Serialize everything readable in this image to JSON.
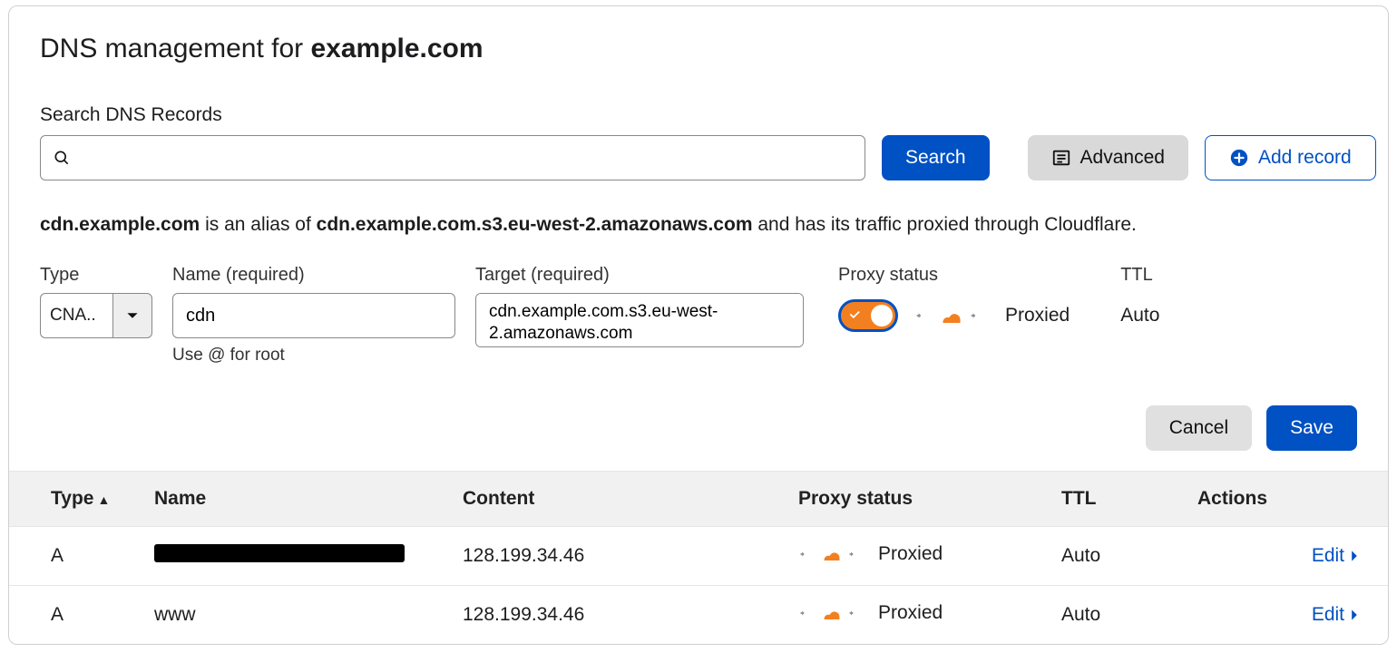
{
  "title_prefix": "DNS management for ",
  "title_domain": "example.com",
  "search": {
    "label": "Search DNS Records",
    "placeholder": "",
    "button": "Search",
    "advanced": "Advanced",
    "add_record": "Add record"
  },
  "alias_sentence": {
    "host": "cdn.example.com",
    "mid": " is an alias of ",
    "target": "cdn.example.com.s3.eu-west-2.amazonaws.com",
    "tail": " and has its traffic proxied through Cloudflare."
  },
  "form": {
    "type_label": "Type",
    "type_value": "CNA..",
    "name_label": "Name (required)",
    "name_value": "cdn",
    "name_hint": "Use @ for root",
    "target_label": "Target (required)",
    "target_value": "cdn.example.com.s3.eu-west-2.amazonaws.com",
    "proxy_label": "Proxy status",
    "proxy_value": "Proxied",
    "ttl_label": "TTL",
    "ttl_value": "Auto",
    "cancel": "Cancel",
    "save": "Save"
  },
  "table": {
    "headers": {
      "type": "Type",
      "name": "Name",
      "content": "Content",
      "proxy": "Proxy status",
      "ttl": "TTL",
      "actions": "Actions"
    },
    "edit_label": "Edit",
    "rows": [
      {
        "type": "A",
        "name_redacted": true,
        "name": "",
        "content": "128.199.34.46",
        "proxy": "Proxied",
        "ttl": "Auto"
      },
      {
        "type": "A",
        "name_redacted": false,
        "name": "www",
        "content": "128.199.34.46",
        "proxy": "Proxied",
        "ttl": "Auto"
      }
    ]
  }
}
